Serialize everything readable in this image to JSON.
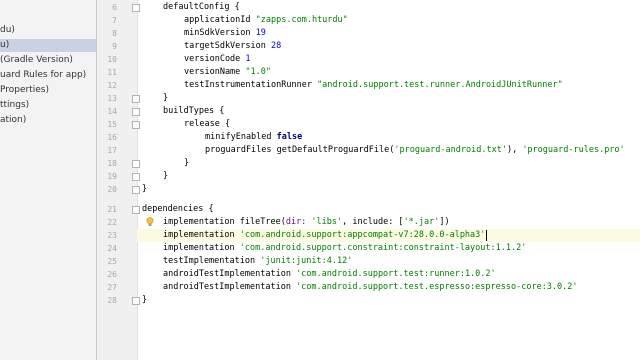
{
  "sidebar": {
    "items": [
      {
        "label": "du)"
      },
      {
        "label": "u)"
      },
      {
        "label": "(Gradle Version)"
      },
      {
        "label": "uard Rules for app)"
      },
      {
        "label": "Properties)"
      },
      {
        "label": "ttings)"
      },
      {
        "label": "ation)"
      }
    ]
  },
  "gutter": {
    "line_numbers": [
      "6",
      "7",
      "8",
      "9",
      "10",
      "11",
      "12",
      "13",
      "14",
      "15",
      "16",
      "17",
      "18",
      "19",
      "20",
      "21",
      "22",
      "23",
      "24",
      "25",
      "26",
      "27",
      "28"
    ]
  },
  "code": {
    "line6": "defaultConfig {",
    "line7_prop": "applicationId ",
    "line7_val": "\"zapps.com.hturdu\"",
    "line8_prop": "minSdkVersion ",
    "line8_val": "19",
    "line9_prop": "targetSdkVersion ",
    "line9_val": "28",
    "line10_prop": "versionCode ",
    "line10_val": "1",
    "line11_prop": "versionName ",
    "line11_val": "\"1.0\"",
    "line12_prop": "testInstrumentationRunner ",
    "line12_val": "\"android.support.test.runner.AndroidJUnitRunner\"",
    "line13": "}",
    "line14": "buildTypes {",
    "line15": "release {",
    "line16_prop": "minifyEnabled ",
    "line16_val": "false",
    "line17_prop": "proguardFiles getDefaultProguardFile(",
    "line17_s1": "'proguard-android.txt'",
    "line17_mid": "), ",
    "line17_s2": "'proguard-rules.pro'",
    "line18": "}",
    "line19": "}",
    "line20": "}",
    "line22": "dependencies {",
    "line23_prop": "implementation fileTree(",
    "line23_dir": "dir: ",
    "line23_s1": "'libs'",
    "line23_inc": ", include: [",
    "line23_s2": "'*.jar'",
    "line23_end": "])",
    "line24_prop": "implementation ",
    "line24_val": "'com.android.support:appcompat-v7:28.0.0-alpha3'",
    "line25_prop": "implementation ",
    "line25_val": "'com.android.support.constraint:constraint-layout:1.1.2'",
    "line26_prop": "testImplementation ",
    "line26_val": "'junit:junit:4.12'",
    "line27_prop": "androidTestImplementation ",
    "line27_val": "'com.android.support.test:runner:1.0.2'",
    "line28_prop": "androidTestImplementation ",
    "line28_val": "'com.android.support.test.espresso:espresso-core:3.0.2'",
    "line29": "}"
  },
  "icons": {
    "intention": "lightbulb-icon"
  }
}
